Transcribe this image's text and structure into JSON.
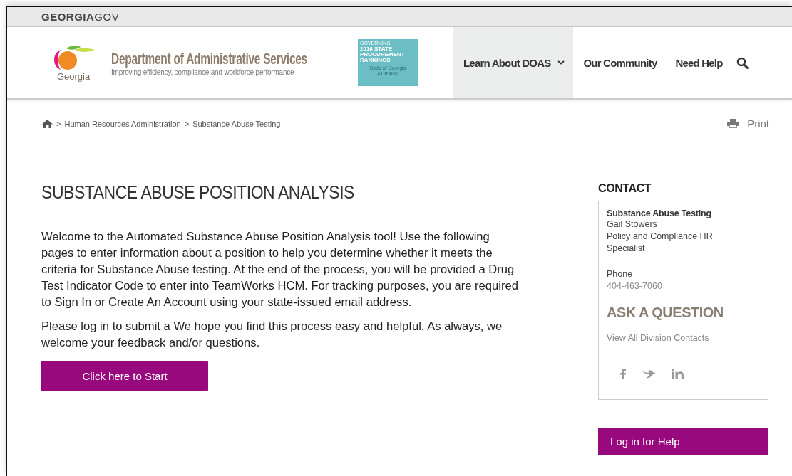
{
  "top_bar": {
    "brand": "**GEORGIA**GOV"
  },
  "header": {
    "logo_text": "Georgia",
    "title": "Department of Administrative Services",
    "tagline": "Improving efficiency, compliance and workforce performance",
    "badge": {
      "kicker": "GOVERNING",
      "heading": "2016 STATE PROCUREMENT RANKINGS",
      "state": "State of Georgia",
      "rank": "#1 RANK"
    },
    "nav": [
      {
        "label": "Learn About DOAS",
        "selected": true,
        "dropdown": true
      },
      {
        "label": "Our Community",
        "selected": false,
        "dropdown": false
      },
      {
        "label": "Need Help",
        "selected": false,
        "dropdown": false
      }
    ]
  },
  "breadcrumb": [
    {
      "separator": ">",
      "label": "Human Resources Administration"
    },
    {
      "separator": ">",
      "label": "Substance Abuse Testing"
    }
  ],
  "print": "Print",
  "main": {
    "title": "SUBSTANCE ABUSE POSITION ANALYSIS",
    "paragraphs": [
      "Welcome to the Automated Substance Abuse Position Analysis tool! Use the following pages to enter information about a position to help you determine whether it meets the criteria for Substance Abuse testing. At the end of the process, you will be provided a Drug Test Indicator Code to enter into TeamWorks HCM. For tracking purposes, you are required to Sign In or Create An Account using your state-issued email address.",
      "Please log in to submit a We hope you find this process easy and helpful. As always, we welcome your feedback and/or questions."
    ],
    "start_button": "Click here to Start"
  },
  "sidebar": {
    "heading": "CONTACT",
    "org": "Substance Abuse Testing",
    "name": "Gail Stowers",
    "role": "Policy and Compliance HR Specialist",
    "phone_label": "Phone",
    "phone": "404-463-7060",
    "ask_heading": "ASK A QUESTION",
    "contacts_link": "View All Division Contacts",
    "help_button": "Log in for Help"
  }
}
